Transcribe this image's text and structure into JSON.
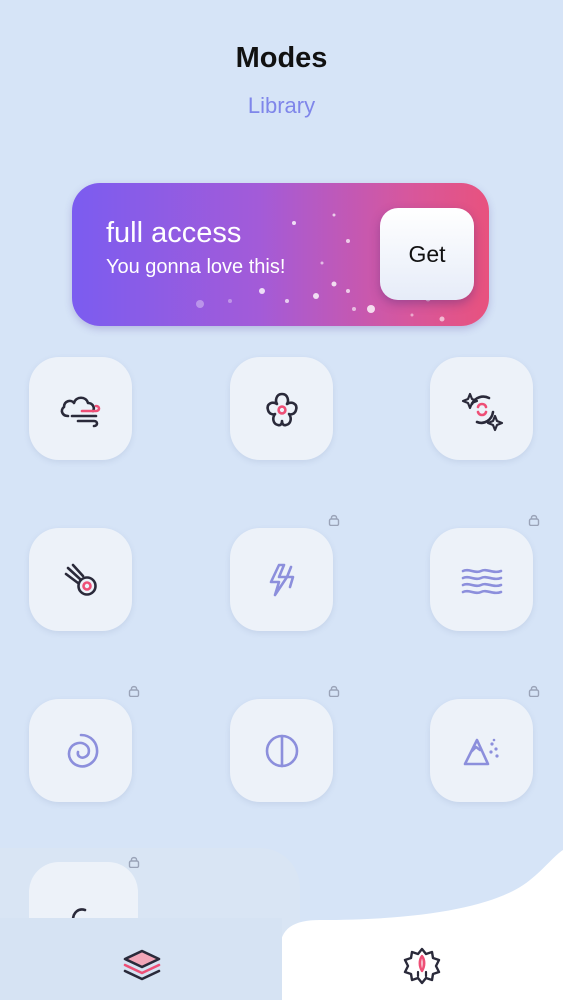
{
  "header": {
    "title": "Modes",
    "subtitle": "Library"
  },
  "promo": {
    "title": "full access",
    "subtitle": "You gonna love this!",
    "button_label": "Get",
    "gradient": [
      "#7b5cf0",
      "#e8527e"
    ]
  },
  "modes": [
    {
      "icon": "cloud-wind-icon",
      "locked": false
    },
    {
      "icon": "flower-icon",
      "locked": false
    },
    {
      "icon": "sparkle-moon-icon",
      "locked": false
    },
    {
      "icon": "comet-icon",
      "locked": false
    },
    {
      "icon": "lightning-icon",
      "locked": true
    },
    {
      "icon": "waves-icon",
      "locked": true
    },
    {
      "icon": "spiral-icon",
      "locked": true
    },
    {
      "icon": "half-circle-icon",
      "locked": true
    },
    {
      "icon": "mountain-icon",
      "locked": true
    },
    {
      "icon": "partial-icon",
      "locked": true
    }
  ],
  "tabs": [
    {
      "icon": "layers-icon",
      "active": true
    },
    {
      "icon": "gear-icon",
      "active": false
    }
  ],
  "colors": {
    "background": "#d6e4f7",
    "accent": "#7f86ea",
    "icon_dark": "#2a2a3a",
    "icon_pink": "#ee4f76",
    "icon_lavender": "#8c8fdc"
  }
}
